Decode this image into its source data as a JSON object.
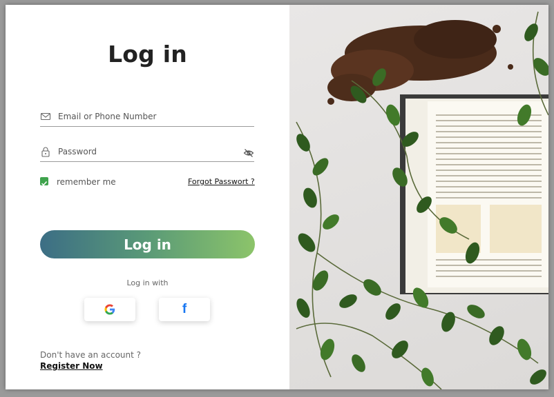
{
  "login": {
    "title": "Log in",
    "email_placeholder": "Email or Phone Number",
    "password_placeholder": "Password",
    "remember_label": "remember me",
    "forgot_label": "Forgot Passwort ?",
    "submit_label": "Log in",
    "login_with_label": "Log in with",
    "google_glyph": "G",
    "facebook_glyph": "f",
    "no_account_text": "Don't have an account ?",
    "register_label": "Register Now"
  },
  "colors": {
    "accent_green": "#3fa34d",
    "button_gradient_start": "#3c6e85",
    "button_gradient_end": "#8cc46a",
    "facebook_blue": "#1877f2"
  },
  "icons": {
    "email": "envelope-icon",
    "password": "lock-icon",
    "toggle_visibility": "eye-off-icon",
    "google": "google-icon",
    "facebook": "facebook-icon"
  }
}
